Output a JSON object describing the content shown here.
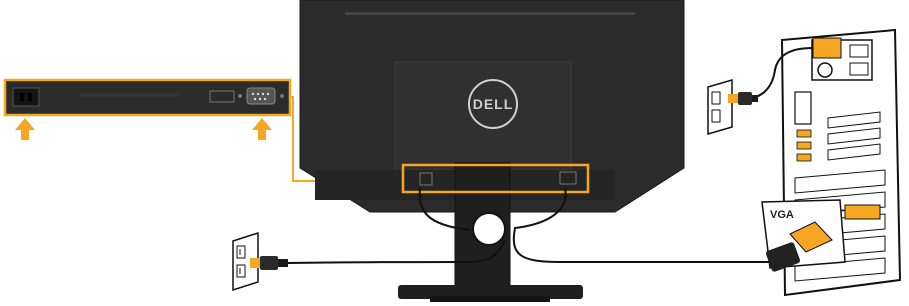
{
  "diagram": {
    "brand_logo": "DELL",
    "vga_label": "VGA",
    "colors": {
      "highlight": "#f5a623",
      "monitor_body": "#2b2b2b",
      "monitor_edge": "#1a1a1a",
      "cable": "#111111",
      "outline": "#1a1a1a"
    },
    "icons": [
      "monitor-back-icon",
      "port-panel-icon",
      "arrow-up-icon",
      "wall-outlet-icon",
      "power-plug-icon",
      "computer-tower-icon",
      "vga-connector-icon"
    ]
  }
}
